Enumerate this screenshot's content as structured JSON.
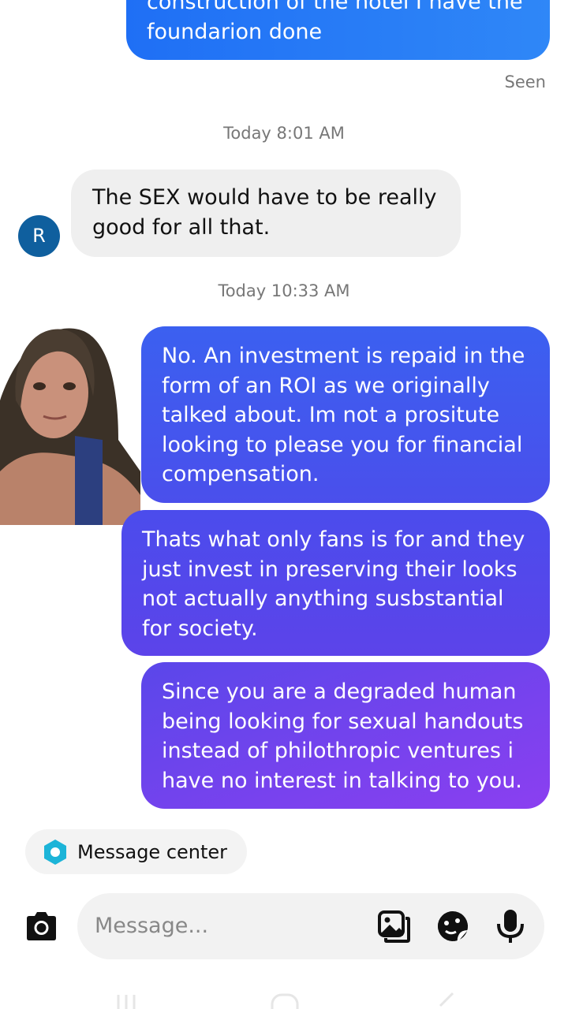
{
  "messages": {
    "out1_tail": "construction of the hotel I have the\nfoundarion done",
    "seen": "Seen",
    "ts1": "Today 8:01 AM",
    "in1": "The SEX would have to be really\ngood for all that.",
    "avatar_initial": "R",
    "ts2": "Today 10:33 AM",
    "out2": "No. An investment is repaid in the\nform of an ROI as we originally\ntalked about. Im not a prositute\nlooking to please you for financial\ncompensation.",
    "out3": "Thats what only fans is for and they\njust invest in preserving their looks\nnot actually anything susbstantial\nfor society.",
    "out4": "Since you are a degraded human\nbeing looking for sexual handouts\ninstead of philothropic ventures i\nhave no interest in talking to you."
  },
  "message_center": {
    "label": "Message center"
  },
  "composer": {
    "placeholder": "Message..."
  },
  "icons": [
    "camera-icon",
    "gallery-icon",
    "sticker-icon",
    "microphone-icon",
    "message-center-icon"
  ],
  "colors": {
    "gradient_top": "#1e74f5",
    "gradient_mid": "#5246ea",
    "gradient_bottom": "#8b3ff0",
    "avatar": "#0f5f9e"
  }
}
